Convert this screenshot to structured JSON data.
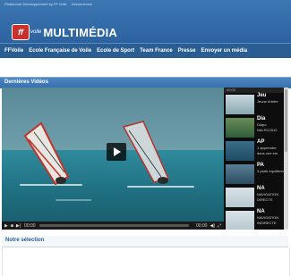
{
  "header": {
    "top_note": [
      "Plateforme Développement by FF Voile",
      "Déconnexion"
    ],
    "logo_badge": "ff",
    "logo_sub": "voile",
    "logo_text": "MULTIMÉDIA"
  },
  "nav": {
    "items": [
      "FFVoile",
      "Ecole Française de Voile",
      "Ecole de Sport",
      "Team France",
      "Presse",
      "Envoyer un média"
    ]
  },
  "latest": {
    "title": "Dernières Vidéos",
    "controls": {
      "time_current": "00:00",
      "time_total": "00:00"
    },
    "sidebar_top": "00:00",
    "items": [
      {
        "title": "Jeu",
        "desc": "Jeune Arbitre"
      },
      {
        "title": "Dia",
        "desc": "Diapo NALRC2010"
      },
      {
        "title": "AP",
        "desc": "1 apprendre dans une em"
      },
      {
        "title": "PA",
        "desc": "3 partir équilibrer"
      },
      {
        "title": "NA",
        "desc": "NAVIGATION DIRECTE"
      },
      {
        "title": "NA",
        "desc": "NAVIGATION INDIRECTE"
      }
    ]
  },
  "selection": {
    "title": "Notre sélection"
  },
  "colors": {
    "brand_blue": "#2a5d91",
    "header_blue": "#3d78b3",
    "player_bg": "#0d0d0d"
  }
}
